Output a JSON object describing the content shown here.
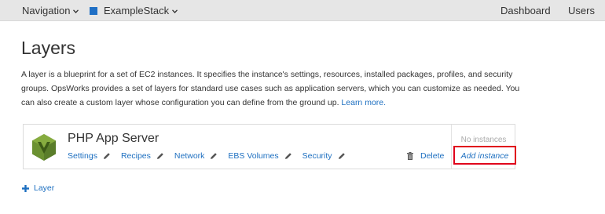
{
  "topbar": {
    "navigation_label": "Navigation",
    "stack_label": "ExampleStack",
    "stack_color": "#1f6fc5",
    "dashboard_label": "Dashboard",
    "users_label": "Users"
  },
  "page": {
    "title": "Layers",
    "description": "A layer is a blueprint for a set of EC2 instances. It specifies the instance's settings, resources, installed packages, profiles, and security groups. OpsWorks provides a set of layers for standard use cases such as application servers, which you can customize as needed. You can also create a custom layer whose configuration you can define from the ground up.",
    "learn_more": "Learn more."
  },
  "layer": {
    "name": "PHP App Server",
    "icon": "php-layer-icon",
    "links": [
      "Settings",
      "Recipes",
      "Network",
      "EBS Volumes",
      "Security"
    ],
    "delete_label": "Delete",
    "instances_status": "No instances",
    "add_instance_label": "Add instance",
    "highlight_color": "#e0001b"
  },
  "add_layer_label": "Layer",
  "colors": {
    "link": "#1d6fc0",
    "topbar_bg": "#e6e6e6"
  }
}
